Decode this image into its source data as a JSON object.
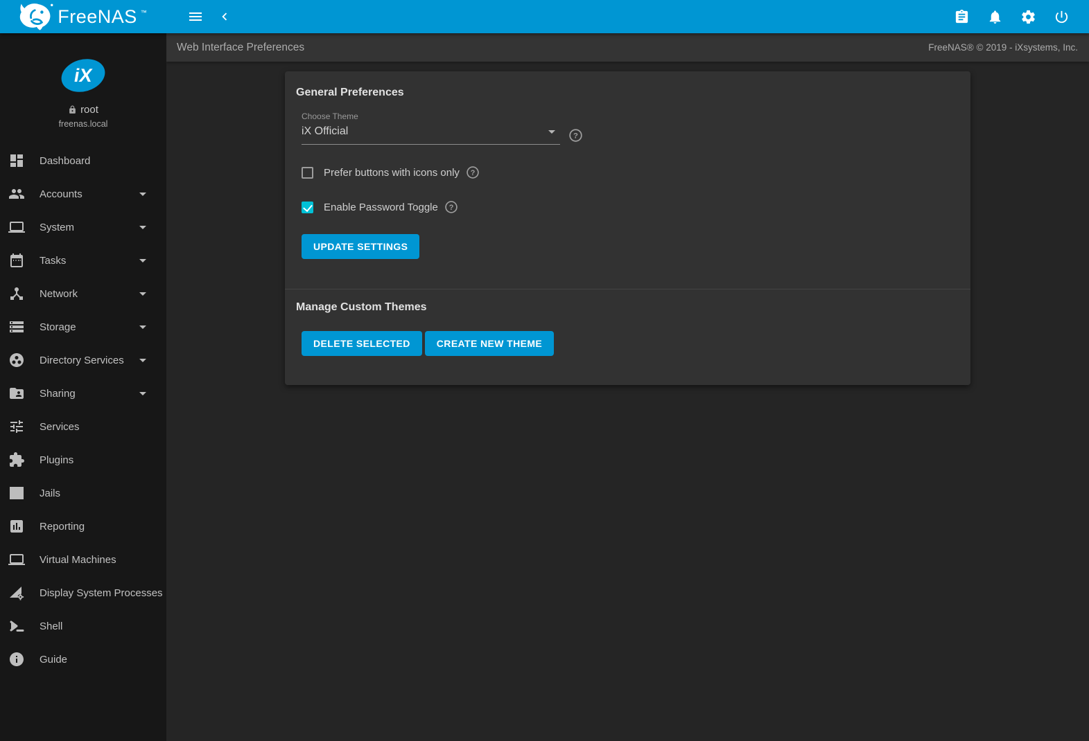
{
  "topbar": {
    "logo_text": "FreeNAS",
    "logo_tm": "™",
    "icons": [
      "menu-icon",
      "back-icon",
      "tasks-manager-icon",
      "notifications-icon",
      "settings-icon",
      "power-icon"
    ]
  },
  "sidebar": {
    "user": {
      "name": "root",
      "host": "freenas.local"
    },
    "items": [
      {
        "label": "Dashboard",
        "icon": "dashboard-icon",
        "expandable": false
      },
      {
        "label": "Accounts",
        "icon": "accounts-icon",
        "expandable": true
      },
      {
        "label": "System",
        "icon": "system-icon",
        "expandable": true
      },
      {
        "label": "Tasks",
        "icon": "tasks-icon",
        "expandable": true
      },
      {
        "label": "Network",
        "icon": "network-icon",
        "expandable": true
      },
      {
        "label": "Storage",
        "icon": "storage-icon",
        "expandable": true
      },
      {
        "label": "Directory Services",
        "icon": "directory-services-icon",
        "expandable": true
      },
      {
        "label": "Sharing",
        "icon": "sharing-icon",
        "expandable": true
      },
      {
        "label": "Services",
        "icon": "services-icon",
        "expandable": false
      },
      {
        "label": "Plugins",
        "icon": "plugins-icon",
        "expandable": false
      },
      {
        "label": "Jails",
        "icon": "jails-icon",
        "expandable": false
      },
      {
        "label": "Reporting",
        "icon": "reporting-icon",
        "expandable": false
      },
      {
        "label": "Virtual Machines",
        "icon": "virtual-machines-icon",
        "expandable": false
      },
      {
        "label": "Display System Processes",
        "icon": "processes-icon",
        "expandable": false
      },
      {
        "label": "Shell",
        "icon": "shell-icon",
        "expandable": false
      },
      {
        "label": "Guide",
        "icon": "guide-icon",
        "expandable": false
      }
    ]
  },
  "header": {
    "title": "Web Interface Preferences",
    "copyright": "FreeNAS® © 2019 - iXsystems, Inc."
  },
  "preferences": {
    "section_title": "General Preferences",
    "theme_label": "Choose Theme",
    "theme_value": "iX Official",
    "checkboxes": [
      {
        "label": "Prefer buttons with icons only",
        "checked": false
      },
      {
        "label": "Enable Password Toggle",
        "checked": true
      }
    ],
    "update_button": "UPDATE SETTINGS"
  },
  "themes_section": {
    "title": "Manage Custom Themes",
    "delete_button": "DELETE SELECTED",
    "create_button": "CREATE NEW THEME"
  },
  "colors": {
    "accent_blue": "#0096d3",
    "checkbox_checked": "#00c1d6",
    "sidebar_bg": "#171717",
    "content_bg": "#252525",
    "card_bg": "#323232"
  }
}
